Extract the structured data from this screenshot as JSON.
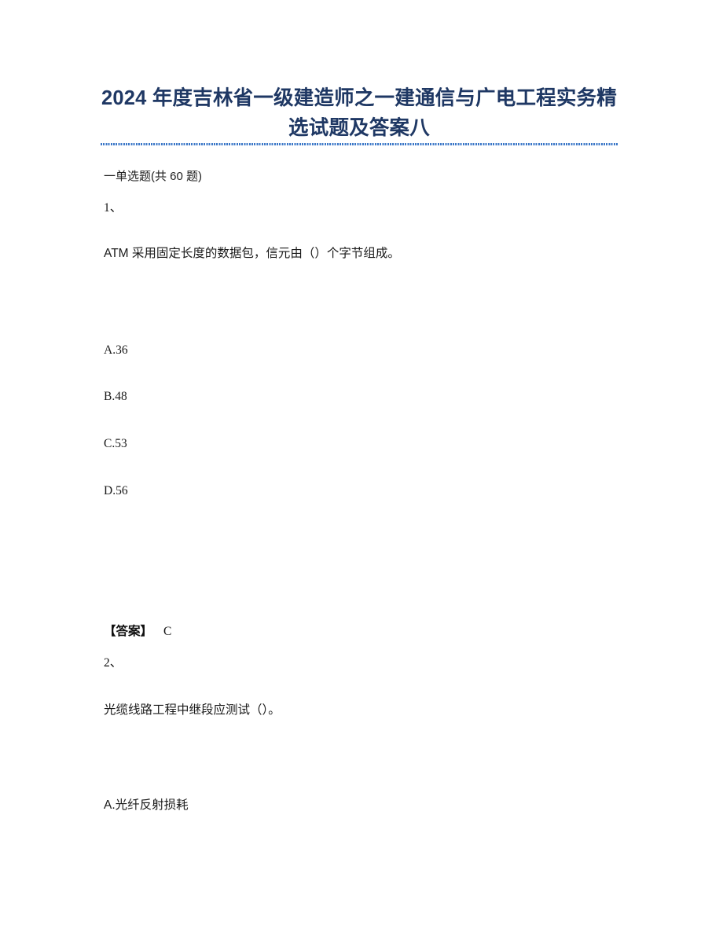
{
  "document": {
    "title": "2024 年度吉林省一级建造师之一建通信与广电工程实务精选试题及答案八",
    "section_heading": "一单选题(共 60 题)",
    "answer_label": "【答案】",
    "divider_color": "#3c78c8",
    "title_color": "#1f3864"
  },
  "questions": [
    {
      "number": "1、",
      "stem": "ATM 采用固定长度的数据包，信元由（）个字节组成。",
      "options": [
        "A.36",
        "B.48",
        "C.53",
        "D.56"
      ],
      "answer": "C"
    },
    {
      "number": "2、",
      "stem": "光缆线路工程中继段应测试（）。",
      "options": [
        "A.光纤反射损耗"
      ],
      "answer": ""
    }
  ]
}
